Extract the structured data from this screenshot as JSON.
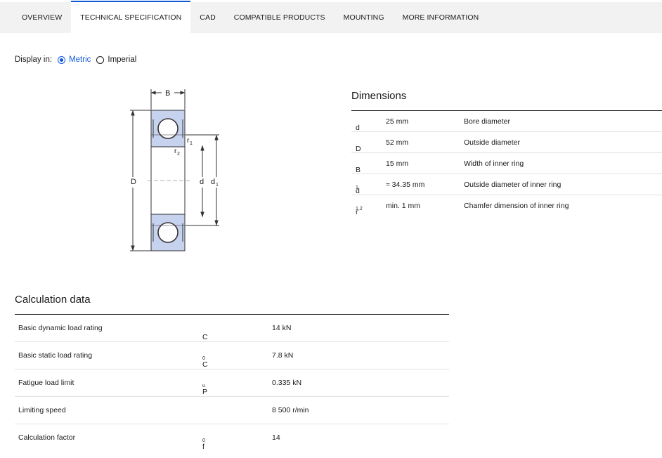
{
  "tabs": [
    {
      "label": "OVERVIEW"
    },
    {
      "label": "TECHNICAL SPECIFICATION",
      "active": true
    },
    {
      "label": "CAD"
    },
    {
      "label": "COMPATIBLE PRODUCTS"
    },
    {
      "label": "MOUNTING"
    },
    {
      "label": "MORE INFORMATION"
    }
  ],
  "display": {
    "label": "Display in:",
    "options": [
      {
        "label": "Metric",
        "selected": true
      },
      {
        "label": "Imperial",
        "selected": false
      }
    ]
  },
  "drawing": {
    "labels": {
      "B": "B",
      "D": "D",
      "d": "d",
      "d1": "d",
      "d1_sub": "1",
      "r1": "r",
      "r1_sub": "1",
      "r2": "r",
      "r2_sub": "2"
    }
  },
  "dimensions": {
    "title": "Dimensions",
    "rows": [
      {
        "symbol": "d",
        "sub": "",
        "value": "25 mm",
        "description": "Bore diameter"
      },
      {
        "symbol": "D",
        "sub": "",
        "value": "52 mm",
        "description": "Outside diameter"
      },
      {
        "symbol": "B",
        "sub": "",
        "value": "15 mm",
        "description": "Width of inner ring"
      },
      {
        "symbol": "d",
        "sub": "1",
        "value": "≈ 34.35 mm",
        "description": "Outside diameter of inner ring"
      },
      {
        "symbol": "r",
        "sub": "1,2",
        "value": "min. 1 mm",
        "description": "Chamfer dimension of inner ring"
      }
    ]
  },
  "calculation": {
    "title": "Calculation data",
    "rows": [
      {
        "label": "Basic dynamic load rating",
        "symbol": "C",
        "sub": "",
        "value": "14 kN"
      },
      {
        "label": "Basic static load rating",
        "symbol": "C",
        "sub": "0",
        "value": "7.8 kN"
      },
      {
        "label": "Fatigue load limit",
        "symbol": "P",
        "sub": "u",
        "value": "0.335 kN"
      },
      {
        "label": "Limiting speed",
        "symbol": "",
        "sub": "",
        "value": "8 500 r/min"
      },
      {
        "label": "Calculation factor",
        "symbol": "f",
        "sub": "0",
        "value": "14"
      }
    ]
  },
  "colors": {
    "accent": "#0f58d6",
    "seal": "#c7d2ee",
    "tab_bg": "#f2f2f2"
  }
}
